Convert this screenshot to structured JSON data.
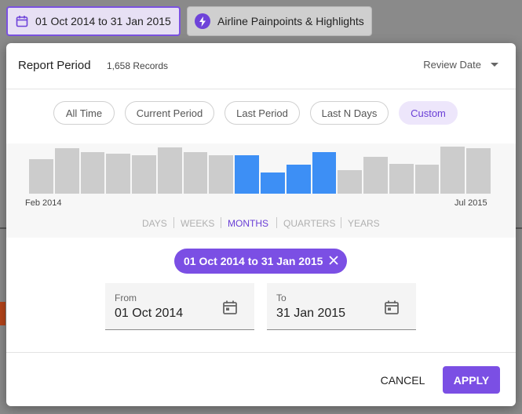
{
  "toolbar": {
    "date_chip_label": "01 Oct 2014 to 31 Jan 2015",
    "lens_chip_label": "Airline Painpoints & Highlights"
  },
  "modal": {
    "title": "Report Period",
    "records": "1,658 Records",
    "date_field_select": "Review Date",
    "presets": [
      {
        "label": "All Time",
        "active": false
      },
      {
        "label": "Current Period",
        "active": false
      },
      {
        "label": "Last Period",
        "active": false
      },
      {
        "label": "Last N Days",
        "active": false
      },
      {
        "label": "Custom",
        "active": true
      }
    ],
    "histogram": {
      "start_label": "Feb 2014",
      "end_label": "Jul 2015",
      "months": [
        {
          "value": 0.71,
          "selected": false
        },
        {
          "value": 0.93,
          "selected": false
        },
        {
          "value": 0.86,
          "selected": false
        },
        {
          "value": 0.82,
          "selected": false
        },
        {
          "value": 0.79,
          "selected": false
        },
        {
          "value": 0.95,
          "selected": false
        },
        {
          "value": 0.86,
          "selected": false
        },
        {
          "value": 0.79,
          "selected": false
        },
        {
          "value": 0.79,
          "selected": true
        },
        {
          "value": 0.43,
          "selected": true
        },
        {
          "value": 0.59,
          "selected": true
        },
        {
          "value": 0.86,
          "selected": true
        },
        {
          "value": 0.48,
          "selected": false
        },
        {
          "value": 0.76,
          "selected": false
        },
        {
          "value": 0.62,
          "selected": false
        },
        {
          "value": 0.6,
          "selected": false
        },
        {
          "value": 0.96,
          "selected": false
        },
        {
          "value": 0.94,
          "selected": false
        }
      ],
      "colors": {
        "selected": "#3d8ff5",
        "unselected": "#cccccc"
      }
    },
    "granularity": [
      {
        "label": "DAYS",
        "active": false
      },
      {
        "label": "WEEKS",
        "active": false
      },
      {
        "label": "MONTHS",
        "active": true
      },
      {
        "label": "QUARTERS",
        "active": false
      },
      {
        "label": "YEARS",
        "active": false
      }
    ],
    "range_chip": "01 Oct 2014 to 31 Jan 2015",
    "from": {
      "label": "From",
      "value": "01 Oct 2014"
    },
    "to": {
      "label": "To",
      "value": "31 Jan 2015"
    },
    "cancel_label": "CANCEL",
    "apply_label": "APPLY"
  },
  "accent_color": "#7b4fe4"
}
